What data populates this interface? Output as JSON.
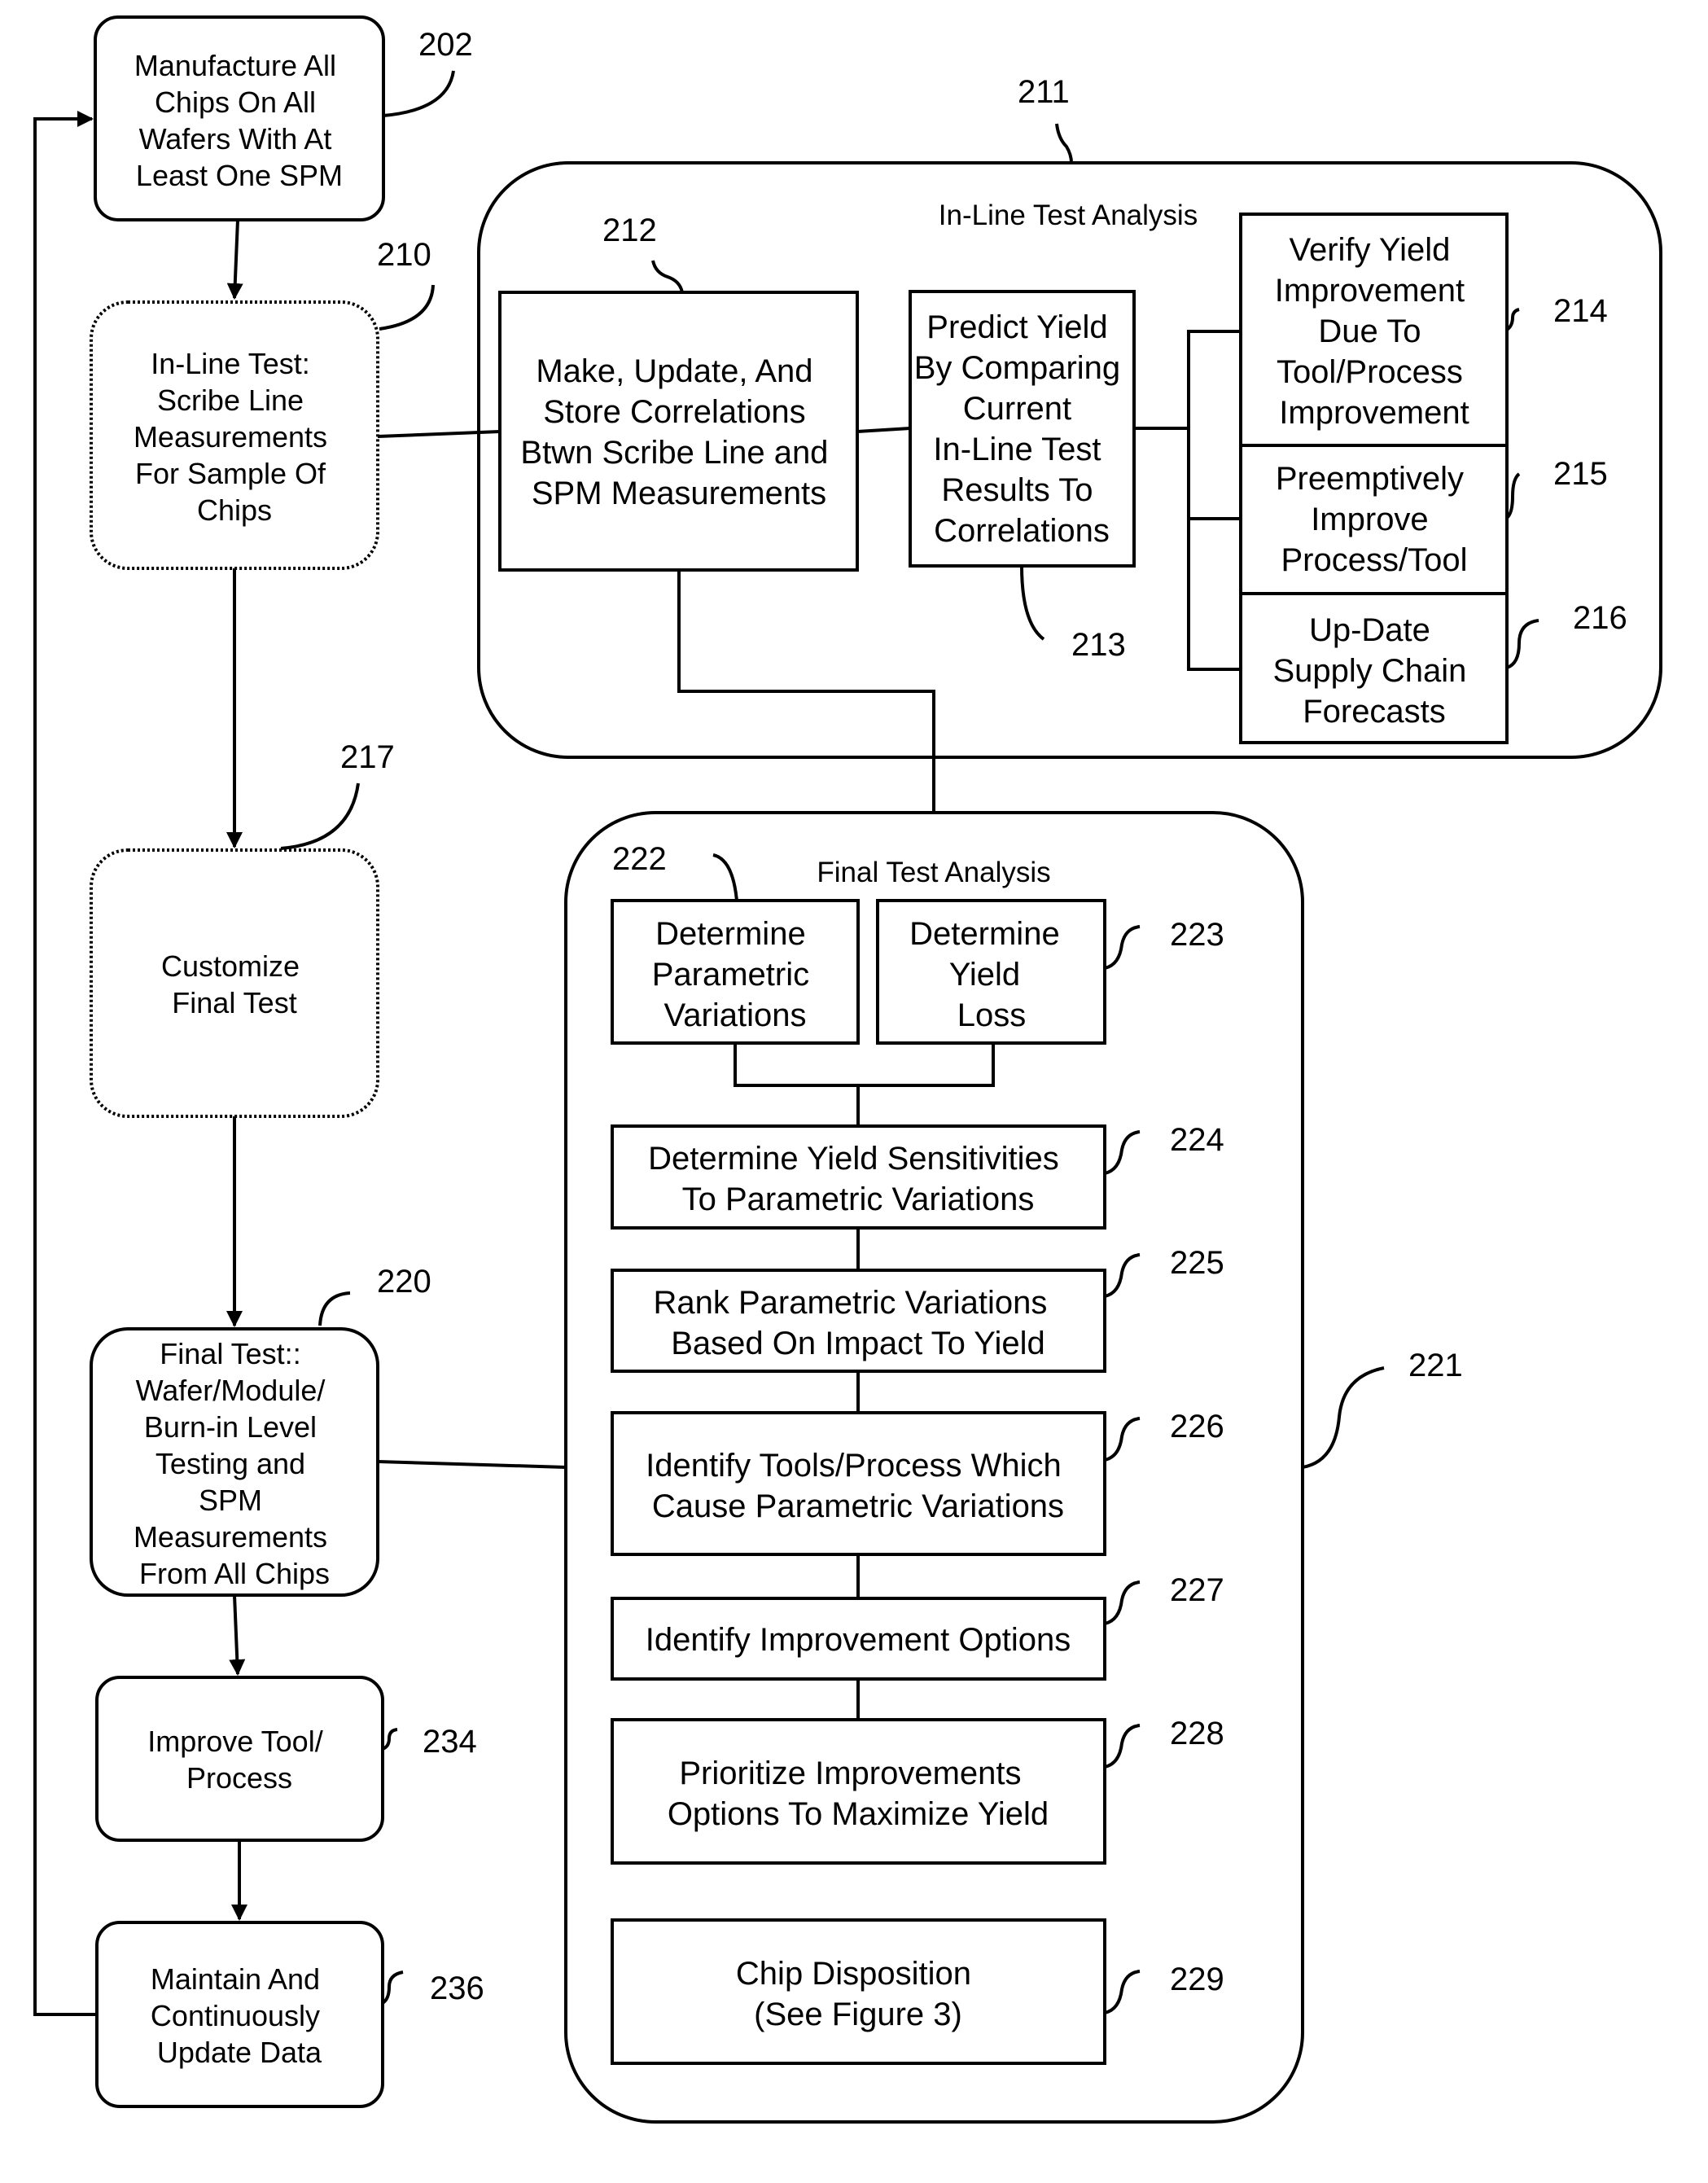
{
  "diagram": {
    "type": "flowchart",
    "nodes": {
      "n202": {
        "ref": "202",
        "lines": [
          "Manufacture All",
          "Chips On All",
          "Wafers With At",
          "Least One SPM"
        ]
      },
      "n210": {
        "ref": "210",
        "lines": [
          "In-Line Test:",
          "Scribe Line",
          "Measurements",
          "For Sample Of",
          "Chips"
        ]
      },
      "n217": {
        "ref": "217",
        "lines": [
          "Customize",
          "Final Test"
        ]
      },
      "n220": {
        "ref": "220",
        "lines": [
          "Final Test::",
          "Wafer/Module/",
          "Burn-in Level",
          "Testing and",
          "SPM",
          "Measurements",
          "From All Chips"
        ]
      },
      "n234": {
        "ref": "234",
        "lines": [
          "Improve Tool/",
          "Process"
        ]
      },
      "n236": {
        "ref": "236",
        "lines": [
          "Maintain And",
          "Continuously",
          "Update Data"
        ]
      },
      "n211": {
        "ref": "211",
        "title": "In-Line Test Analysis"
      },
      "n212": {
        "ref": "212",
        "lines": [
          "Make, Update, And",
          "Store Correlations",
          "Btwn Scribe Line and",
          "SPM Measurements"
        ]
      },
      "n213": {
        "ref": "213",
        "lines": [
          "Predict Yield",
          "By Comparing",
          "Current",
          "In-Line Test",
          "Results To",
          "Correlations"
        ]
      },
      "n214": {
        "ref": "214",
        "lines": [
          "Verify Yield",
          "Improvement",
          "Due To",
          "Tool/Process",
          "Improvement"
        ]
      },
      "n215": {
        "ref": "215",
        "lines": [
          "Preemptively",
          "Improve",
          "Process/Tool"
        ]
      },
      "n216": {
        "ref": "216",
        "lines": [
          "Up-Date",
          "Supply Chain",
          "Forecasts"
        ]
      },
      "n221": {
        "ref": "221",
        "title": "Final Test Analysis"
      },
      "n222": {
        "ref": "222",
        "lines": [
          "Determine",
          "Parametric",
          "Variations"
        ]
      },
      "n223": {
        "ref": "223",
        "lines": [
          "Determine",
          "Yield",
          "Loss"
        ]
      },
      "n224": {
        "ref": "224",
        "lines": [
          "Determine Yield Sensitivities",
          "To Parametric Variations"
        ]
      },
      "n225": {
        "ref": "225",
        "lines": [
          "Rank Parametric Variations",
          "Based On Impact To Yield"
        ]
      },
      "n226": {
        "ref": "226",
        "lines": [
          "Identify Tools/Process Which",
          "Cause Parametric Variations"
        ]
      },
      "n227": {
        "ref": "227",
        "lines": [
          "Identify Improvement Options"
        ]
      },
      "n228": {
        "ref": "228",
        "lines": [
          "Prioritize Improvements",
          "Options To Maximize Yield"
        ]
      },
      "n229": {
        "ref": "229",
        "lines": [
          "Chip Disposition",
          "(See Figure 3)"
        ]
      }
    },
    "edges": [
      {
        "from": "202",
        "to": "210",
        "arrow": true
      },
      {
        "from": "210",
        "to": "217",
        "arrow": true
      },
      {
        "from": "217",
        "to": "220",
        "arrow": true
      },
      {
        "from": "220",
        "to": "234",
        "arrow": true
      },
      {
        "from": "234",
        "to": "236",
        "arrow": true
      },
      {
        "from": "236",
        "to": "202",
        "arrow": true
      },
      {
        "from": "210",
        "to": "212",
        "arrow": false
      },
      {
        "from": "212",
        "to": "213",
        "arrow": false
      },
      {
        "from": "213",
        "to": "214",
        "arrow": false
      },
      {
        "from": "213",
        "to": "215",
        "arrow": false
      },
      {
        "from": "213",
        "to": "216",
        "arrow": false
      },
      {
        "from": "212",
        "to": "221",
        "arrow": false
      },
      {
        "from": "220",
        "to": "221",
        "arrow": false
      },
      {
        "from": "222",
        "to": "224",
        "arrow": false
      },
      {
        "from": "223",
        "to": "224",
        "arrow": false
      },
      {
        "from": "224",
        "to": "225",
        "arrow": false
      },
      {
        "from": "225",
        "to": "226",
        "arrow": false
      },
      {
        "from": "226",
        "to": "227",
        "arrow": false
      },
      {
        "from": "227",
        "to": "228",
        "arrow": false
      }
    ]
  }
}
